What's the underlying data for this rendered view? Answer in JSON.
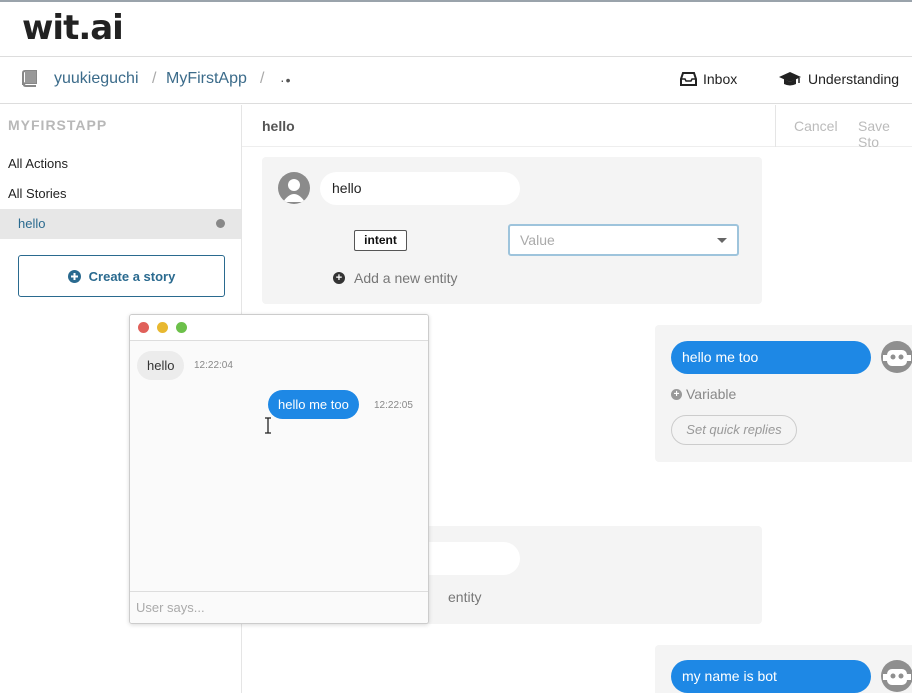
{
  "brand": {
    "logo": "wit.ai"
  },
  "breadcrumb": {
    "user": "yuukieguchi",
    "app": "MyFirstApp",
    "separator": "/",
    "more": "·•"
  },
  "nav": {
    "inbox": "Inbox",
    "understanding": "Understanding"
  },
  "sidebar": {
    "title": "MYFIRSTAPP",
    "items": [
      {
        "label": "All Actions"
      },
      {
        "label": "All Stories"
      },
      {
        "label": "hello"
      }
    ],
    "create_button": "Create a story"
  },
  "story": {
    "title": "hello",
    "cancel": "Cancel",
    "save": "Save Sto",
    "user_turn_1": {
      "message": "hello",
      "entity_name": "intent",
      "value_placeholder": "Value",
      "add_entity": "Add a new entity"
    },
    "bot_turn_1": {
      "message": "hello me too",
      "variable": "Variable",
      "quick_replies": "Set quick replies"
    },
    "user_turn_2": {
      "add_entity_partial": "entity"
    },
    "bot_turn_2": {
      "message": "my name is bot"
    }
  },
  "chat_window": {
    "messages": [
      {
        "from": "user",
        "text": "hello",
        "time": "12:22:04"
      },
      {
        "from": "bot",
        "text": "hello me too",
        "time": "12:22:05"
      }
    ],
    "input_placeholder": "User says..."
  },
  "colors": {
    "accent": "#1e88e5",
    "link": "#3b6b8a",
    "close": "#e0605a",
    "minimize": "#e8b830",
    "maximize": "#6cc04a"
  }
}
